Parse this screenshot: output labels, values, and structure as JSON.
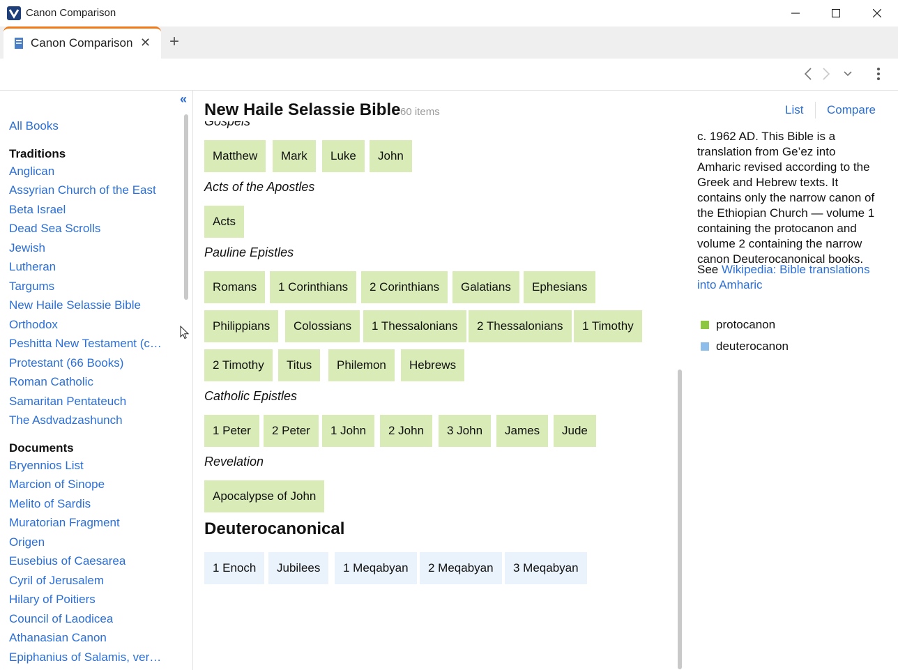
{
  "window": {
    "title": "Canon Comparison",
    "tab_label": "Canon Comparison"
  },
  "sidebar": {
    "all_books": "All Books",
    "traditions_heading": "Traditions",
    "traditions": [
      "Anglican",
      "Assyrian Church of the East",
      "Beta Israel",
      "Dead Sea Scrolls",
      "Jewish",
      "Lutheran",
      "Targums",
      "New Haile Selassie Bible",
      "Orthodox",
      "Peshitta New Testament (ca…",
      "Protestant (66 Books)",
      "Roman Catholic",
      "Samaritan Pentateuch",
      "The Asdvadzashunch"
    ],
    "documents_heading": "Documents",
    "documents": [
      "Bryennios List",
      "Marcion of Sinope",
      "Melito of Sardis",
      "Muratorian Fragment",
      "Origen",
      "Eusebius of Caesarea",
      "Cyril of Jerusalem",
      "Hilary of Poitiers",
      "Council of Laodicea",
      "Athanasian Canon",
      "Epiphanius of Salamis, vers…"
    ]
  },
  "main": {
    "title": "New Haile Selassie Bible",
    "count": "60 items",
    "list_link": "List",
    "compare_link": "Compare",
    "groups": [
      {
        "label": "Gospels",
        "books": [
          "Matthew",
          "Mark",
          "Luke",
          "John"
        ]
      },
      {
        "label": "Acts of the Apostles",
        "books": [
          "Acts"
        ]
      },
      {
        "label": "Pauline Epistles",
        "books": [
          "Romans",
          "1 Corinthians",
          "2 Corinthians",
          "Galatians",
          "Ephesians",
          "Philippians",
          "Colossians",
          "1 Thessalonians",
          "2 Thessalonians",
          "1 Timothy",
          "2 Timothy",
          "Titus",
          "Philemon",
          "Hebrews"
        ]
      },
      {
        "label": "Catholic Epistles",
        "books": [
          "1 Peter",
          "2 Peter",
          "1 John",
          "2 John",
          "3 John",
          "James",
          "Jude"
        ]
      },
      {
        "label": "Revelation",
        "books": [
          "Apocalypse of John"
        ]
      }
    ],
    "deutero_heading": "Deuterocanonical",
    "deutero_books": [
      "1 Enoch",
      "Jubilees",
      "1 Meqabyan",
      "2 Meqabyan",
      "3 Meqabyan"
    ],
    "description": "c. 1962 AD. This Bible is a translation from Ge’ez into Amharic revised according to the Greek and Hebrew texts. It contains only the narrow canon of the Ethiopian Church — volume 1 containing the protocanon and volume 2 containing the narrow canon Deuterocanonical books.",
    "see_prefix": "See ",
    "see_link": "Wikipedia: Bible translations into Amharic",
    "legend": [
      {
        "label": "protocanon",
        "color": "#8dc63f"
      },
      {
        "label": "deuterocanon",
        "color": "#8dbdea"
      }
    ]
  }
}
